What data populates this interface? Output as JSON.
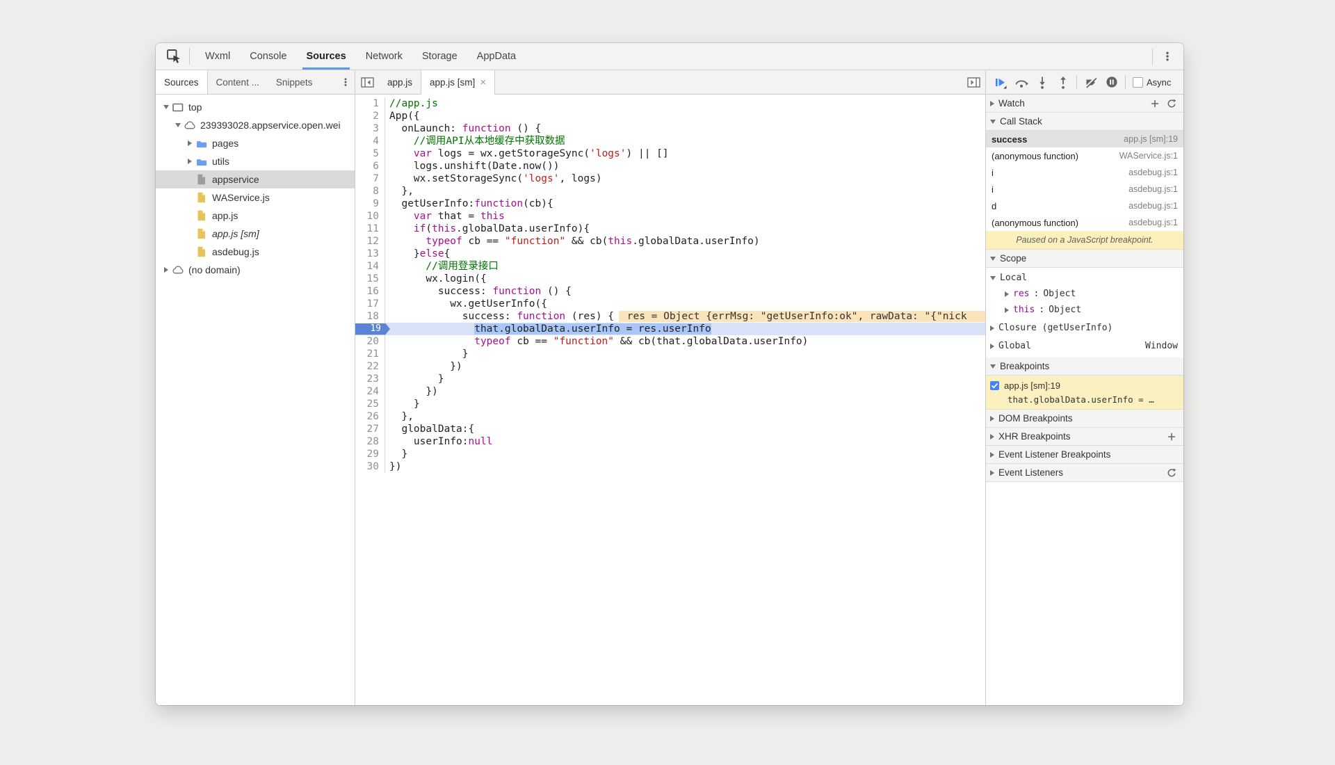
{
  "icons": {
    "close": "×"
  },
  "toolbar": {
    "tabs": [
      {
        "label": "Wxml"
      },
      {
        "label": "Console"
      },
      {
        "label": "Sources",
        "active": true
      },
      {
        "label": "Network"
      },
      {
        "label": "Storage"
      },
      {
        "label": "AppData"
      }
    ]
  },
  "sidebar": {
    "tabs": [
      {
        "label": "Sources",
        "active": true
      },
      {
        "label": "Content ..."
      },
      {
        "label": "Snippets"
      }
    ],
    "tree": [
      {
        "label": "top",
        "icon": "frame",
        "depth": 0,
        "arrow": "expanded"
      },
      {
        "label": "239393028.appservice.open.wei",
        "icon": "cloud",
        "depth": 1,
        "arrow": "expanded"
      },
      {
        "label": "pages",
        "icon": "folder",
        "depth": 2,
        "arrow": "collapsed"
      },
      {
        "label": "utils",
        "icon": "folder",
        "depth": 2,
        "arrow": "collapsed"
      },
      {
        "label": "appservice",
        "icon": "file-gray",
        "depth": 2,
        "selected": true
      },
      {
        "label": "WAService.js",
        "icon": "file-yellow",
        "depth": 2
      },
      {
        "label": "app.js",
        "icon": "file-yellow",
        "depth": 2
      },
      {
        "label": "app.js [sm]",
        "icon": "file-yellow",
        "depth": 2,
        "italic": true
      },
      {
        "label": "asdebug.js",
        "icon": "file-yellow",
        "depth": 2
      },
      {
        "label": "(no domain)",
        "icon": "cloud",
        "depth": 0,
        "arrow": "collapsed"
      }
    ]
  },
  "editor": {
    "tabs": [
      {
        "label": "app.js"
      },
      {
        "label": "app.js [sm]",
        "active": true,
        "closable": true
      }
    ],
    "inline_value": " res = Object {errMsg: \"getUserInfo:ok\", rawData: \"{\"nick",
    "lines": [
      {
        "n": 1,
        "segs": [
          [
            "c",
            "//app.js"
          ]
        ]
      },
      {
        "n": 2,
        "segs": [
          [
            "p",
            "App({"
          ]
        ]
      },
      {
        "n": 3,
        "segs": [
          [
            "p",
            "  onLaunch: "
          ],
          [
            "k",
            "function"
          ],
          [
            "p",
            " () {"
          ]
        ]
      },
      {
        "n": 4,
        "segs": [
          [
            "p",
            "    "
          ],
          [
            "c",
            "//调用API从本地缓存中获取数据"
          ]
        ]
      },
      {
        "n": 5,
        "segs": [
          [
            "p",
            "    "
          ],
          [
            "k",
            "var"
          ],
          [
            "p",
            " logs = wx.getStorageSync("
          ],
          [
            "s",
            "'logs'"
          ],
          [
            "p",
            ") || []"
          ]
        ]
      },
      {
        "n": 6,
        "segs": [
          [
            "p",
            "    logs.unshift(Date.now())"
          ]
        ]
      },
      {
        "n": 7,
        "segs": [
          [
            "p",
            "    wx.setStorageSync("
          ],
          [
            "s",
            "'logs'"
          ],
          [
            "p",
            ", logs)"
          ]
        ]
      },
      {
        "n": 8,
        "segs": [
          [
            "p",
            "  },"
          ]
        ]
      },
      {
        "n": 9,
        "segs": [
          [
            "p",
            "  getUserInfo:"
          ],
          [
            "k",
            "function"
          ],
          [
            "p",
            "(cb){"
          ]
        ]
      },
      {
        "n": 10,
        "segs": [
          [
            "p",
            "    "
          ],
          [
            "k",
            "var"
          ],
          [
            "p",
            " that = "
          ],
          [
            "k",
            "this"
          ]
        ]
      },
      {
        "n": 11,
        "segs": [
          [
            "p",
            "    "
          ],
          [
            "k",
            "if"
          ],
          [
            "p",
            "("
          ],
          [
            "k",
            "this"
          ],
          [
            "p",
            ".globalData.userInfo){"
          ]
        ]
      },
      {
        "n": 12,
        "segs": [
          [
            "p",
            "      "
          ],
          [
            "k",
            "typeof"
          ],
          [
            "p",
            " cb == "
          ],
          [
            "s",
            "\"function\""
          ],
          [
            "p",
            " && cb("
          ],
          [
            "k",
            "this"
          ],
          [
            "p",
            ".globalData.userInfo)"
          ]
        ]
      },
      {
        "n": 13,
        "segs": [
          [
            "p",
            "    }"
          ],
          [
            "k",
            "else"
          ],
          [
            "p",
            "{"
          ]
        ]
      },
      {
        "n": 14,
        "segs": [
          [
            "p",
            "      "
          ],
          [
            "c",
            "//调用登录接口"
          ]
        ]
      },
      {
        "n": 15,
        "segs": [
          [
            "p",
            "      wx.login({"
          ]
        ]
      },
      {
        "n": 16,
        "segs": [
          [
            "p",
            "        success: "
          ],
          [
            "k",
            "function"
          ],
          [
            "p",
            " () {"
          ]
        ]
      },
      {
        "n": 17,
        "segs": [
          [
            "p",
            "          wx.getUserInfo({"
          ]
        ]
      },
      {
        "n": 18,
        "segs": [
          [
            "p",
            "            success: "
          ],
          [
            "k",
            "function"
          ],
          [
            "p",
            " (res) {"
          ]
        ],
        "inline_value": true
      },
      {
        "n": 19,
        "segs": [
          [
            "p",
            "              "
          ],
          [
            "hl",
            "that.globalData.userInfo = res.userInfo"
          ]
        ],
        "exec": true
      },
      {
        "n": 20,
        "segs": [
          [
            "p",
            "              "
          ],
          [
            "k",
            "typeof"
          ],
          [
            "p",
            " cb == "
          ],
          [
            "s",
            "\"function\""
          ],
          [
            "p",
            " && cb(that.globalData.userInfo)"
          ]
        ]
      },
      {
        "n": 21,
        "segs": [
          [
            "p",
            "            }"
          ]
        ]
      },
      {
        "n": 22,
        "segs": [
          [
            "p",
            "          })"
          ]
        ]
      },
      {
        "n": 23,
        "segs": [
          [
            "p",
            "        }"
          ]
        ]
      },
      {
        "n": 24,
        "segs": [
          [
            "p",
            "      })"
          ]
        ]
      },
      {
        "n": 25,
        "segs": [
          [
            "p",
            "    }"
          ]
        ]
      },
      {
        "n": 26,
        "segs": [
          [
            "p",
            "  },"
          ]
        ]
      },
      {
        "n": 27,
        "segs": [
          [
            "p",
            "  globalData:{"
          ]
        ]
      },
      {
        "n": 28,
        "segs": [
          [
            "p",
            "    userInfo:"
          ],
          [
            "k",
            "null"
          ]
        ]
      },
      {
        "n": 29,
        "segs": [
          [
            "p",
            "  }"
          ]
        ]
      },
      {
        "n": 30,
        "segs": [
          [
            "p",
            "})"
          ]
        ]
      }
    ]
  },
  "debugger": {
    "async_label": "Async",
    "watch_label": "Watch",
    "call_stack_label": "Call Stack",
    "frames": [
      {
        "fn": "success",
        "loc": "app.js [sm]:19",
        "selected": true
      },
      {
        "fn": "(anonymous function)",
        "loc": "WAService.js:1"
      },
      {
        "fn": "i",
        "loc": "asdebug.js:1"
      },
      {
        "fn": "i",
        "loc": "asdebug.js:1"
      },
      {
        "fn": "d",
        "loc": "asdebug.js:1"
      },
      {
        "fn": "(anonymous function)",
        "loc": "asdebug.js:1"
      }
    ],
    "paused_message": "Paused on a JavaScript breakpoint.",
    "scope_label": "Scope",
    "scope": [
      {
        "label": "Local",
        "expanded": true,
        "children": [
          {
            "name": "res",
            "value": "Object"
          },
          {
            "name": "this",
            "value": "Object"
          }
        ]
      },
      {
        "label": "Closure (getUserInfo)"
      },
      {
        "label": "Global",
        "value": "Window"
      }
    ],
    "breakpoints_label": "Breakpoints",
    "breakpoint": {
      "checked": true,
      "label": "app.js [sm]:19",
      "snippet": "that.globalData.userInfo = …"
    },
    "bottom_sections": [
      {
        "label": "DOM Breakpoints"
      },
      {
        "label": "XHR Breakpoints",
        "action": "plus"
      },
      {
        "label": "Event Listener Breakpoints"
      },
      {
        "label": "Event Listeners",
        "action": "refresh"
      }
    ]
  }
}
